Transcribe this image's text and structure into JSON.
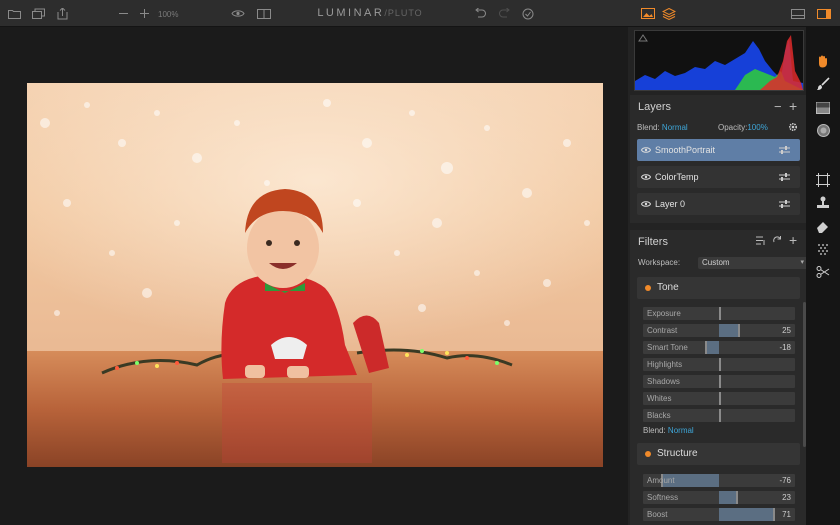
{
  "app": {
    "brand": "LUMINAR",
    "edition": "/PLUTO",
    "zoom": "100%"
  },
  "toolbar_icons": [
    "folder-icon",
    "layers-copy-icon",
    "export-icon",
    "zoom-out-icon",
    "zoom-in-icon",
    "eye-icon",
    "compare-icon",
    "undo-icon",
    "redo-icon",
    "check-icon",
    "image-icon",
    "stack-icon",
    "panel-bottom-icon",
    "panel-right-icon"
  ],
  "layers": {
    "title": "Layers",
    "blend_label": "Blend:",
    "blend_value": "Normal",
    "opacity_label": "Opacity:",
    "opacity_value": "100%",
    "items": [
      {
        "name": "SmoothPortrait",
        "active": true
      },
      {
        "name": "ColorTemp",
        "active": false
      },
      {
        "name": "Layer 0",
        "active": false
      }
    ]
  },
  "filters": {
    "title": "Filters",
    "workspace_label": "Workspace:",
    "workspace_value": "Custom",
    "tone": {
      "title": "Tone",
      "sliders": [
        {
          "name": "Exposure",
          "value": "",
          "level": 0
        },
        {
          "name": "Contrast",
          "value": "25",
          "level": 25
        },
        {
          "name": "Smart Tone",
          "value": "-18",
          "level": -18
        },
        {
          "name": "Highlights",
          "value": "",
          "level": 0
        },
        {
          "name": "Shadows",
          "value": "",
          "level": 0
        },
        {
          "name": "Whites",
          "value": "",
          "level": 0
        },
        {
          "name": "Blacks",
          "value": "",
          "level": 0
        }
      ],
      "blend_label": "Blend:",
      "blend_value": "Normal"
    },
    "structure": {
      "title": "Structure",
      "sliders": [
        {
          "name": "Amount",
          "value": "-76",
          "level": -76
        },
        {
          "name": "Softness",
          "value": "23",
          "level": 23
        },
        {
          "name": "Boost",
          "value": "71",
          "level": 71
        }
      ]
    }
  },
  "tools": [
    "hand-icon",
    "brush-icon",
    "gradient-icon",
    "radial-icon",
    "crop-icon",
    "stamp-icon",
    "eraser-icon",
    "noise-icon",
    "scissors-icon"
  ],
  "colors": {
    "accent": "#3ea6d8",
    "active_layer": "#5f7ea6",
    "tone_dot": "#f08a2a",
    "tool_orange": "#f08a2a"
  }
}
